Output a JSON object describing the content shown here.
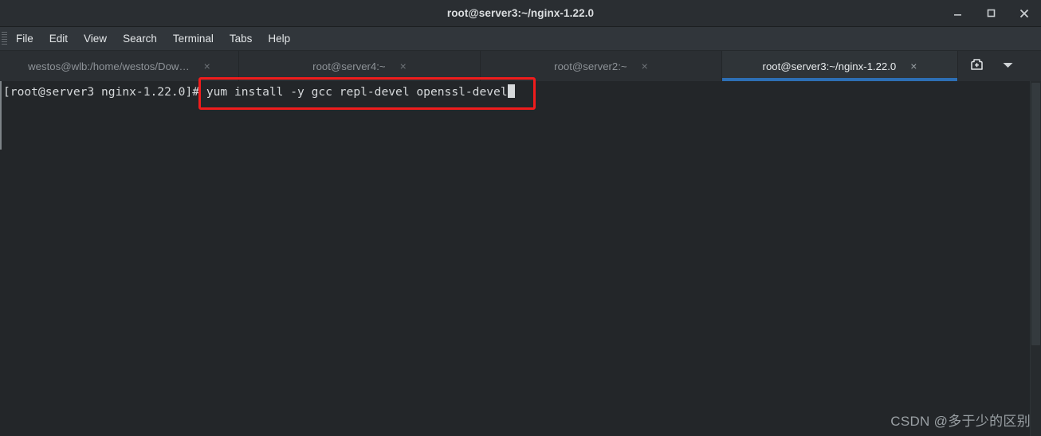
{
  "window": {
    "title": "root@server3:~/nginx-1.22.0",
    "controls": {
      "minimize": "minimize",
      "maximize": "maximize",
      "close": "close"
    }
  },
  "menubar": {
    "items": [
      {
        "label": "File"
      },
      {
        "label": "Edit"
      },
      {
        "label": "View"
      },
      {
        "label": "Search"
      },
      {
        "label": "Terminal"
      },
      {
        "label": "Tabs"
      },
      {
        "label": "Help"
      }
    ]
  },
  "tabbar": {
    "tabs": [
      {
        "label": "westos@wlb:/home/westos/Dow…",
        "close": "×",
        "active": false
      },
      {
        "label": "root@server4:~",
        "close": "×",
        "active": false
      },
      {
        "label": "root@server2:~",
        "close": "×",
        "active": false
      },
      {
        "label": "root@server3:~/nginx-1.22.0",
        "close": "×",
        "active": true
      }
    ],
    "new_tab_label": "new-tab",
    "tab_menu_label": "tab-list-menu",
    "active_indicator_color": "#2d6fb5"
  },
  "terminal": {
    "prompt": "[root@server3 nginx-1.22.0]# ",
    "command": "yum install -y gcc repl-devel openssl-devel",
    "cursor": "block",
    "foreground": "#d6d9db",
    "background": "#232629"
  },
  "annotation": {
    "highlight_color": "#f01c1c",
    "target": "yum install -y gcc repl-devel openssl-devel"
  },
  "watermark": {
    "text": "CSDN @多于少的区别"
  }
}
